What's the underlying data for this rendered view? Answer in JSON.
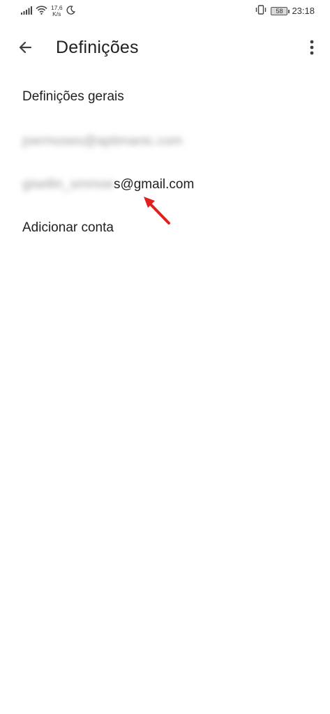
{
  "status_bar": {
    "network_speed_value": "17,6",
    "network_speed_unit": "K/s",
    "battery": "58",
    "time": "23:18",
    "icons": [
      "signal-icon",
      "wifi-icon",
      "moon-icon",
      "vibrate-icon",
      "battery-icon"
    ]
  },
  "app_bar": {
    "title": "Definições",
    "back_icon": "arrow-back-icon",
    "menu_icon": "more-vert-icon"
  },
  "list": {
    "general": "Definições gerais",
    "account1_blurred": "joermoses@aptimanic.com",
    "account2_blurred": "gisellin_smmoe",
    "account2_visible": "s@gmail.com",
    "add_account": "Adicionar conta"
  },
  "colors": {
    "annotation_arrow": "#e0201c",
    "text_primary": "#202124"
  }
}
